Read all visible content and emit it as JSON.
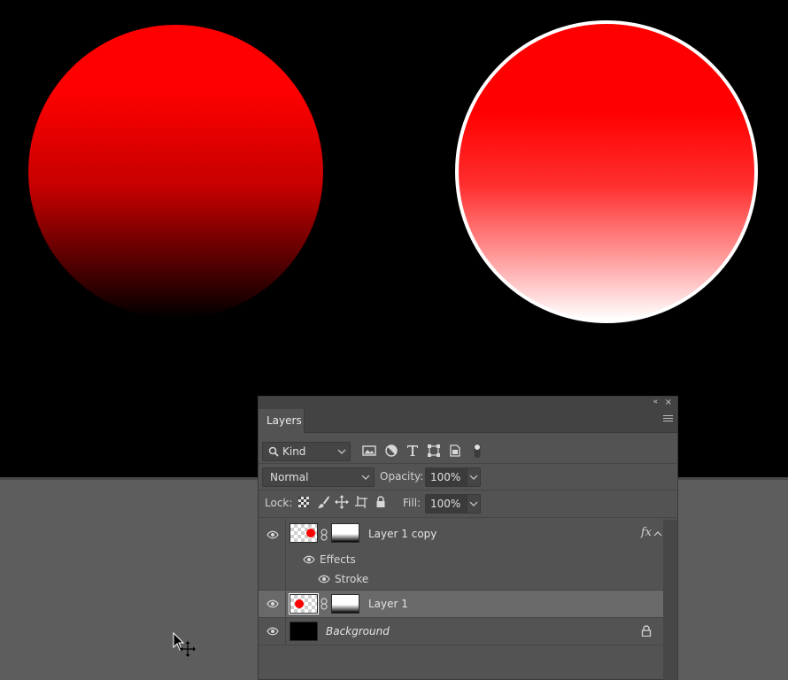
{
  "panel": {
    "tab_label": "Layers",
    "collapse_glyph": "«",
    "close_glyph": "×"
  },
  "filter": {
    "kind_label": "Kind",
    "icons": [
      "image-filter-icon",
      "adjustment-filter-icon",
      "type-filter-icon",
      "shape-filter-icon",
      "smart-object-filter-icon",
      "filter-toggle-icon"
    ]
  },
  "blend": {
    "mode": "Normal",
    "opacity_label": "Opacity:",
    "opacity_value": "100%"
  },
  "lock": {
    "label": "Lock:",
    "icons": [
      "lock-transparent-pixels-icon",
      "lock-image-pixels-icon",
      "lock-position-icon",
      "lock-artboard-icon",
      "lock-all-icon"
    ],
    "fill_label": "Fill:",
    "fill_value": "100%"
  },
  "layers": [
    {
      "name": "Layer 1 copy",
      "fx": "fx",
      "effects_label": "Effects",
      "effect_items": [
        "Stroke"
      ],
      "selected": false
    },
    {
      "name": "Layer 1",
      "selected": true
    },
    {
      "name": "Background",
      "locked": true,
      "selected": false
    }
  ],
  "colors": {
    "canvas": "#000000",
    "red": "#ff0000",
    "panel_bg": "#535353",
    "selected_row": "#696969",
    "pasteboard": "#5d5d5d"
  }
}
